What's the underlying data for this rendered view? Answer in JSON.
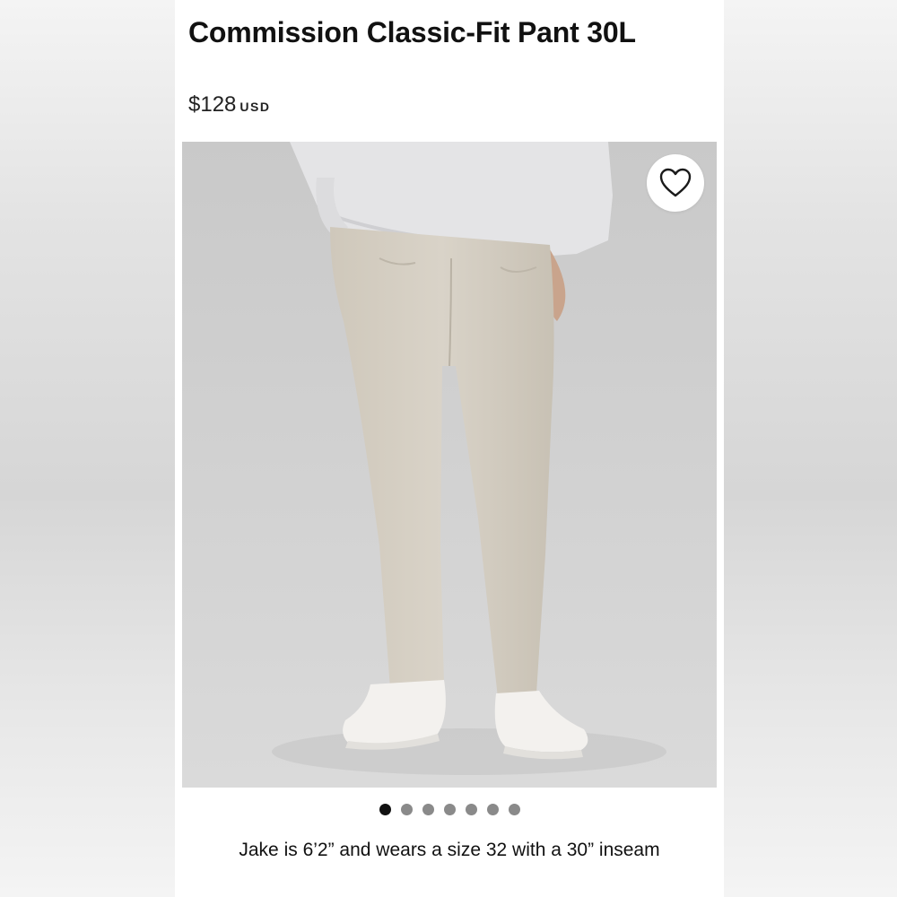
{
  "product": {
    "title": "Commission Classic-Fit Pant 30L",
    "price": "$128",
    "currency": "USD",
    "image_alt": "Model wearing light beige Commission Classic-Fit Pant with grey sweatshirt and white sneakers",
    "caption": "Jake is 6’2” and wears a size 32 with a 30” inseam"
  },
  "favorite": {
    "icon": "heart-icon",
    "active": false
  },
  "gallery": {
    "total": 7,
    "active_index": 0
  },
  "colors": {
    "title": "#111111",
    "dot_active": "#111111",
    "dot_inactive": "#8a8a8a",
    "pant": "#d6d0c4",
    "background_photo": "#cfcfcf"
  }
}
